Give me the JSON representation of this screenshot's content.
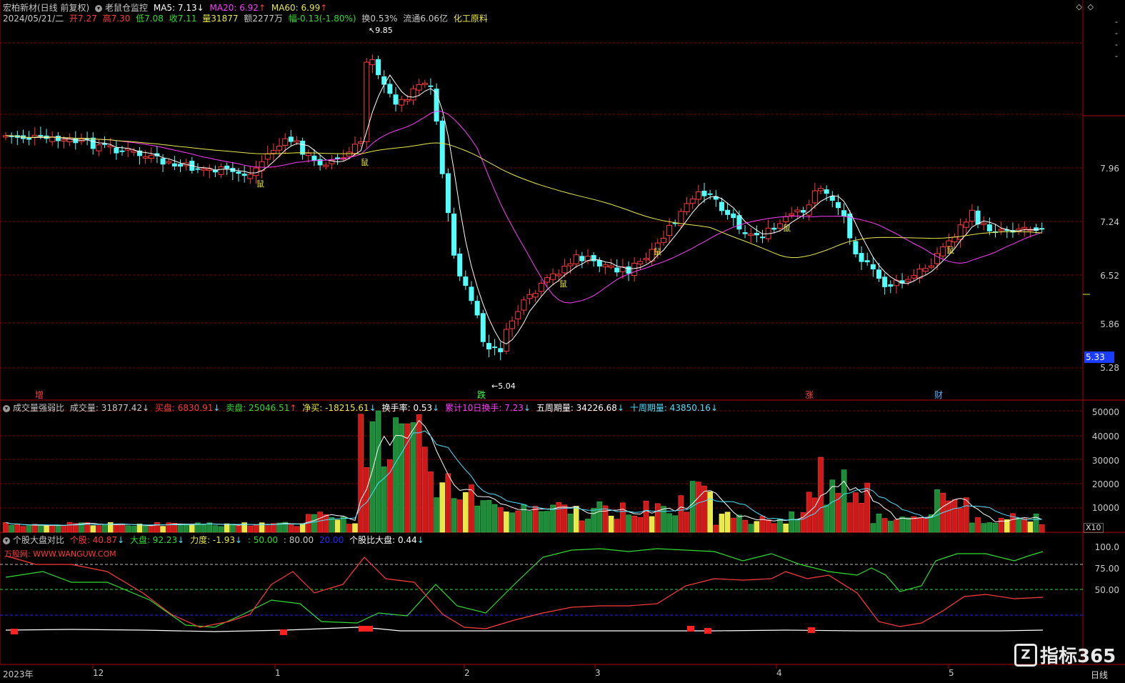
{
  "main_header": {
    "stock_name": "宏柏新材(日线 前复权)",
    "indicator_name": "老鼠仓监控",
    "ma5": "MA5: 7.13",
    "ma20": "MA20: 6.92",
    "ma60": "MA60: 6.99"
  },
  "quote_line": {
    "date": "2024/05/21/二",
    "open": "开7.27",
    "high": "高7.30",
    "low": "低7.08",
    "close": "收7.11",
    "volume": "量31877",
    "amount": "额2277万",
    "change": "幅-0.13(-1.80%)",
    "turnover": "换0.53%",
    "float_cap": "流通6.06亿",
    "industry": "化工原料"
  },
  "price_axis": [
    "7.96",
    "7.24",
    "6.52",
    "5.86",
    "5.28"
  ],
  "current_price_tag": "5.33",
  "peak_label": "9.85",
  "trough_label": "5.04",
  "event_markers": [
    "增",
    "跌",
    "涨",
    "财"
  ],
  "rat_markers": [
    "鼠",
    "鼠",
    "鼠",
    "鼠",
    "鼠",
    "鼠",
    "鼠"
  ],
  "vol_header": {
    "name": "成交量强弱比",
    "volume": "成交量: 31877.42",
    "buy": "买盘: 6830.91",
    "sell": "卖盘: 25046.51",
    "net": "净买: -18215.61",
    "turnover": "换手率: 0.53",
    "turnover10": "累计10日换手: 7.23",
    "wk5": "五周期量: 34226.68",
    "wk10": "十周期量: 43850.16"
  },
  "vol_axis": [
    "50000",
    "40000",
    "30000",
    "20000",
    "10000"
  ],
  "vol_unit": "X10",
  "cmp_header": {
    "name": "个股大盘对比",
    "stock": "个股: 40.87",
    "market": "大盘: 92.23",
    "force": "力度: -1.93",
    "l50": ": 50.00",
    "l80": ": 80.00",
    "l20": "20.00",
    "ratio": "个股比大盘: 0.44"
  },
  "watermark_text": "万股网: WWW.WANGUW.COM",
  "cmp_axis": [
    "100.0",
    "75.00",
    "50.00"
  ],
  "time_axis": [
    "2023年",
    "12",
    "1",
    "2",
    "3",
    "4",
    "5"
  ],
  "period_button": "日线",
  "brand": "指标365",
  "colors": {
    "up": "#ff3b3b",
    "down": "#54ffff",
    "ma5": "#ffffff",
    "ma20": "#ff3cff",
    "ma60": "#e8e84a",
    "grid": "#8a0000"
  },
  "chart_data": {
    "type": "candlestick",
    "ma5_value": 7.13,
    "ma20_value": 6.92,
    "ma60_value": 6.99,
    "price_range": [
      5.04,
      9.85
    ],
    "current_close": 7.11
  }
}
